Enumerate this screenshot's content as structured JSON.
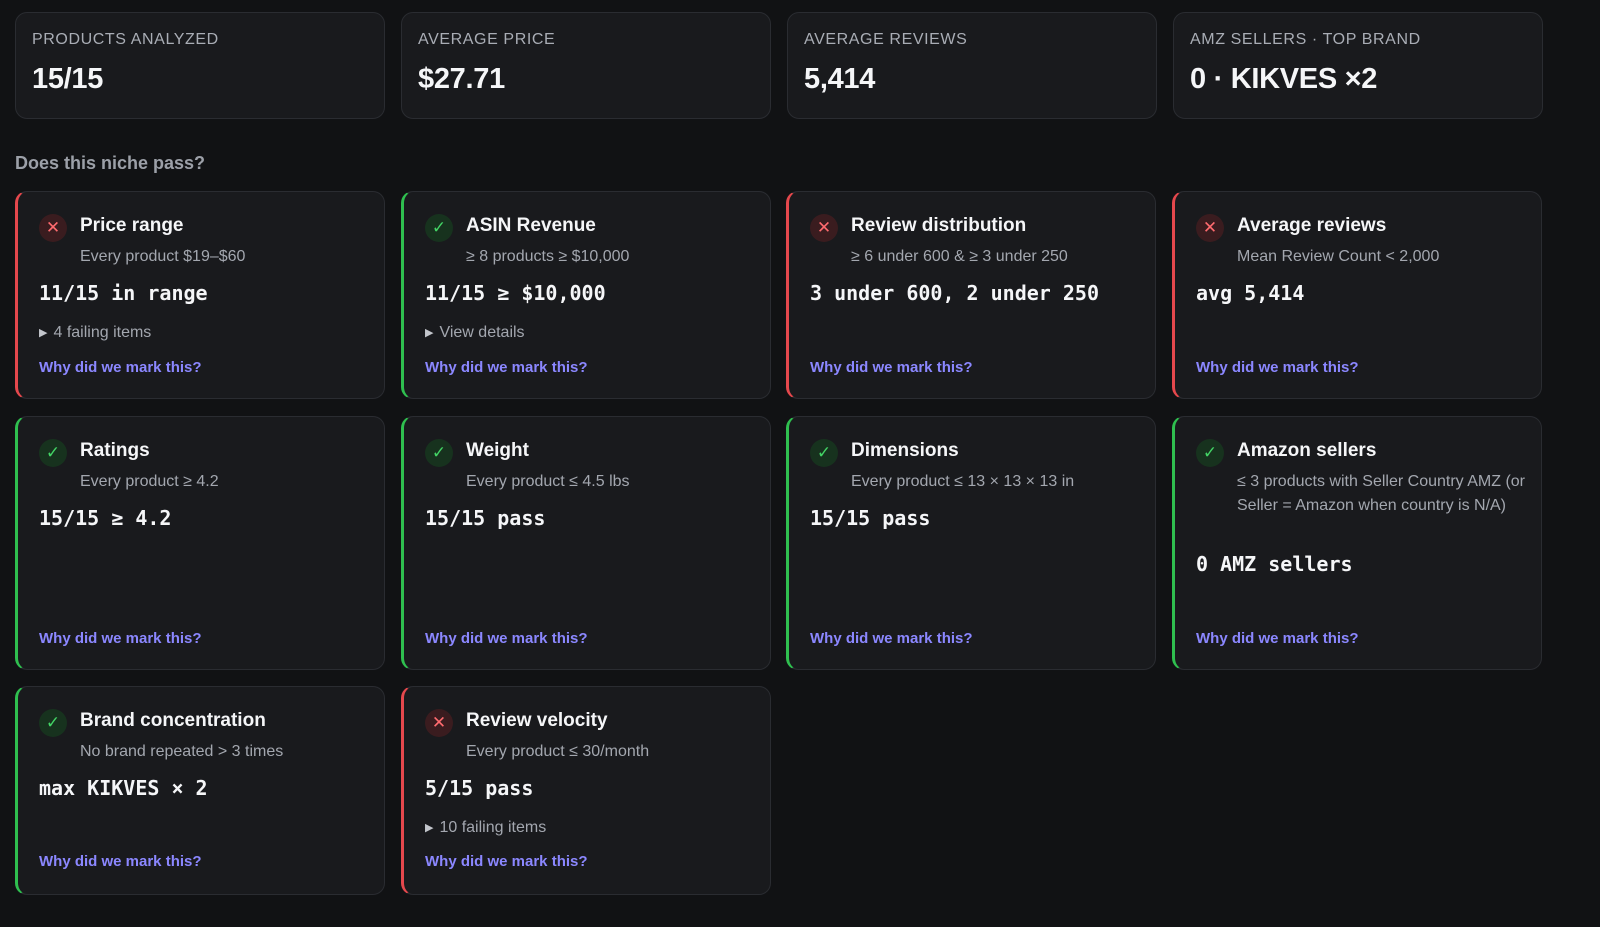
{
  "stats": [
    {
      "label": "PRODUCTS ANALYZED",
      "value": "15/15"
    },
    {
      "label": "AVERAGE PRICE",
      "value": "$27.71"
    },
    {
      "label": "AVERAGE REVIEWS",
      "value": "5,414"
    },
    {
      "label": "AMZ SELLERS · TOP BRAND",
      "value": "0 · KIKVES ×2"
    }
  ],
  "section_heading": "Does this niche pass?",
  "status_icons": {
    "pass": "✓",
    "fail": "✕"
  },
  "colors": {
    "pass": "#2fbf4f",
    "fail": "#e5484d",
    "link": "#8b87ff"
  },
  "criteria": [
    {
      "title": "Price range",
      "subtitle": "Every product $19–$60",
      "metric": "11/15 in range",
      "toggle": "4 failing items",
      "why": "Why did we mark this?",
      "status": "fail"
    },
    {
      "title": "ASIN Revenue",
      "subtitle": "≥ 8 products ≥ $10,000",
      "metric": "11/15 ≥ $10,000",
      "toggle": "View details",
      "why": "Why did we mark this?",
      "status": "pass"
    },
    {
      "title": "Review distribution",
      "subtitle": "≥ 6 under 600 & ≥ 3 under 250",
      "metric": "3 under 600, 2 under 250",
      "why": "Why did we mark this?",
      "status": "fail"
    },
    {
      "title": "Average reviews",
      "subtitle": "Mean Review Count < 2,000",
      "metric": "avg 5,414",
      "why": "Why did we mark this?",
      "status": "fail"
    },
    {
      "title": "Ratings",
      "subtitle": "Every product ≥ 4.2",
      "metric": "15/15 ≥ 4.2",
      "why": "Why did we mark this?",
      "status": "pass"
    },
    {
      "title": "Weight",
      "subtitle": "Every product ≤ 4.5 lbs",
      "metric": "15/15 pass",
      "why": "Why did we mark this?",
      "status": "pass"
    },
    {
      "title": "Dimensions",
      "subtitle": "Every product ≤ 13 × 13 × 13 in",
      "metric": "15/15 pass",
      "why": "Why did we mark this?",
      "status": "pass"
    },
    {
      "title": "Amazon sellers",
      "subtitle": "≤ 3 products with Seller Country AMZ (or Seller = Amazon when country is N/A)",
      "metric": "0 AMZ sellers",
      "why": "Why did we mark this?",
      "status": "pass"
    },
    {
      "title": "Brand concentration",
      "subtitle": "No brand repeated > 3 times",
      "metric": "max KIKVES × 2",
      "why": "Why did we mark this?",
      "status": "pass"
    },
    {
      "title": "Review velocity",
      "subtitle": "Every product ≤ 30/month",
      "metric": "5/15 pass",
      "toggle": "10 failing items",
      "why": "Why did we mark this?",
      "status": "fail"
    }
  ]
}
